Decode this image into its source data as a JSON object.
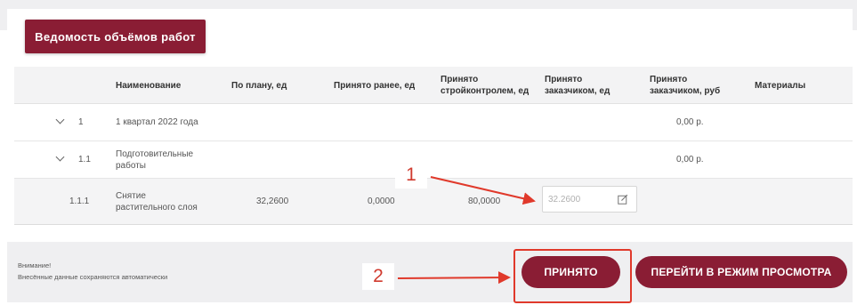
{
  "title": "Ведомость объёмов работ",
  "table": {
    "headers": {
      "name": "Наименование",
      "plan": "По плану, ед",
      "accepted_before": "Принято ранее, ед",
      "accepted_construction_1": "Принято",
      "accepted_construction_2": "стройконтролем, ед",
      "accepted_customer_units_1": "Принято",
      "accepted_customer_units_2": "заказчиком, ед",
      "accepted_customer_rub_1": "Принято",
      "accepted_customer_rub_2": "заказчиком, руб",
      "materials": "Материалы"
    },
    "rows": [
      {
        "code": "1",
        "name": "1 квартал 2022 года",
        "rub": "0,00 р."
      },
      {
        "code": "1.1",
        "name_1": "Подготовительные",
        "name_2": "работы",
        "rub": "0,00 р."
      },
      {
        "code": "1.1.1",
        "name_1": "Снятие",
        "name_2": "растительного слоя",
        "plan": "32,2600",
        "accepted_before": "0,0000",
        "accepted_construction": "80,0000",
        "input_placeholder": "32.2600"
      }
    ]
  },
  "footer": {
    "warning_title": "Внимание!",
    "warning_text": "Внесённые данные сохраняются автоматически",
    "accept_button": "ПРИНЯТО",
    "view_mode_button": "ПЕРЕЙТИ В РЕЖИМ ПРОСМОТРА"
  },
  "annotations": {
    "label_1": "1",
    "label_2": "2",
    "color": "#e0392b"
  }
}
